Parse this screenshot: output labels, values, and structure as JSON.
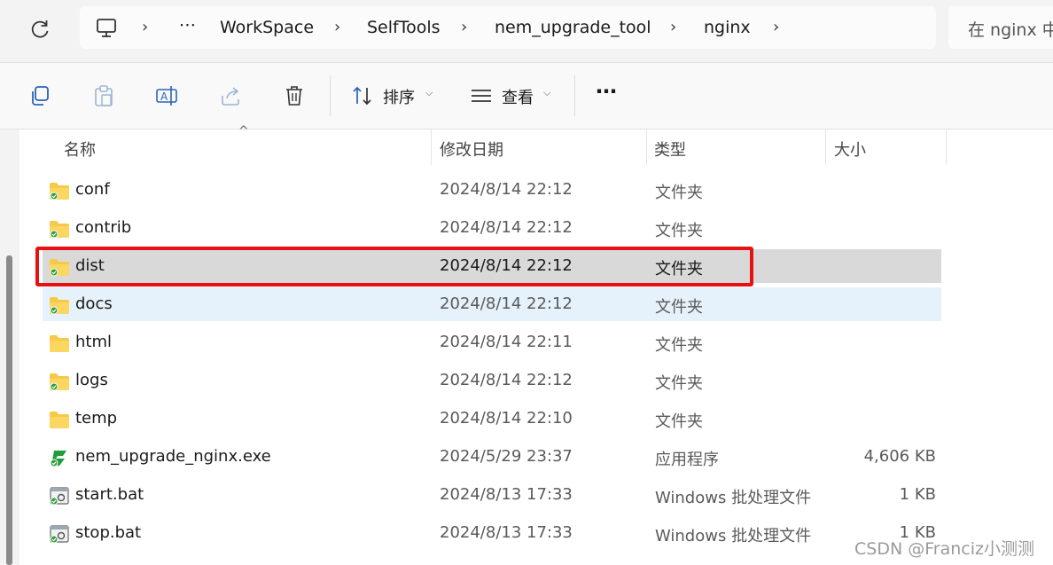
{
  "address_bar": {
    "overflow": "⋯",
    "crumbs": [
      "WorkSpace",
      "SelfTools",
      "nem_upgrade_tool",
      "nginx"
    ]
  },
  "search": {
    "placeholder": "在 nginx 中"
  },
  "toolbar": {
    "sort_label": "排序",
    "view_label": "查看",
    "more_label": "⋯"
  },
  "columns": {
    "name": "名称",
    "date": "修改日期",
    "type": "类型",
    "size": "大小"
  },
  "files": [
    {
      "name": "conf",
      "date": "2024/8/14 22:12",
      "type": "文件夹",
      "size": "",
      "icon": "folder-icon"
    },
    {
      "name": "contrib",
      "date": "2024/8/14 22:12",
      "type": "文件夹",
      "size": "",
      "icon": "folder-icon"
    },
    {
      "name": "dist",
      "date": "2024/8/14 22:12",
      "type": "文件夹",
      "size": "",
      "icon": "folder-icon",
      "state": "selected",
      "highlighted": true
    },
    {
      "name": "docs",
      "date": "2024/8/14 22:12",
      "type": "文件夹",
      "size": "",
      "icon": "folder-icon",
      "state": "hover"
    },
    {
      "name": "html",
      "date": "2024/8/14 22:11",
      "type": "文件夹",
      "size": "",
      "icon": "folder-icon"
    },
    {
      "name": "logs",
      "date": "2024/8/14 22:12",
      "type": "文件夹",
      "size": "",
      "icon": "folder-icon"
    },
    {
      "name": "temp",
      "date": "2024/8/14 22:10",
      "type": "文件夹",
      "size": "",
      "icon": "folder-icon"
    },
    {
      "name": "nem_upgrade_nginx.exe",
      "date": "2024/5/29 23:37",
      "type": "应用程序",
      "size": "4,606 KB",
      "icon": "exe-icon"
    },
    {
      "name": "start.bat",
      "date": "2024/8/13 17:33",
      "type": "Windows 批处理文件",
      "size": "1 KB",
      "icon": "bat-icon"
    },
    {
      "name": "stop.bat",
      "date": "2024/8/13 17:33",
      "type": "Windows 批处理文件",
      "size": "1 KB",
      "icon": "bat-icon"
    }
  ],
  "watermark": "CSDN @Franciz小测测",
  "colors": {
    "highlight_box": "#e81010",
    "selected_row": "#d9d9d9",
    "hover_row": "#e5f1fb",
    "folder": "#f7c948",
    "sync_badge": "#2e9e3e"
  }
}
